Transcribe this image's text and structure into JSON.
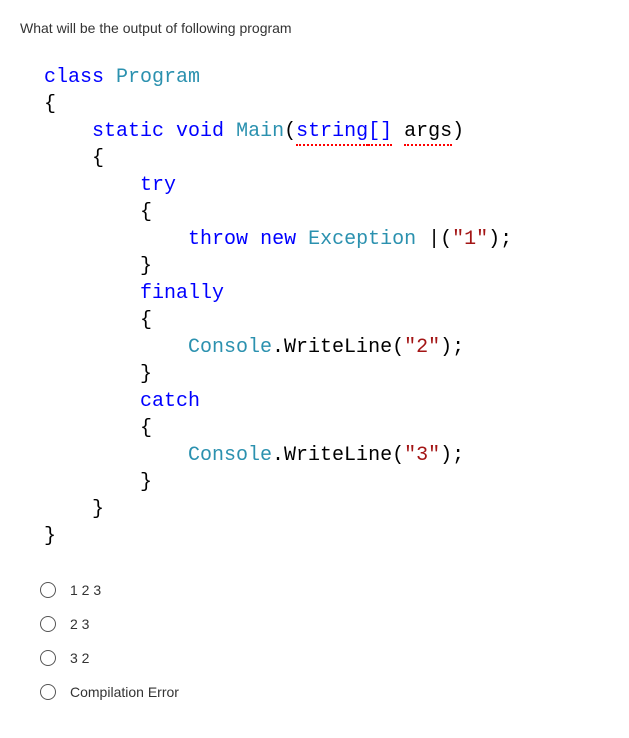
{
  "question": {
    "title": "What will be the output of following program"
  },
  "code": {
    "l1_kw1": "class",
    "l1_cls": "Program",
    "l2_brace": "{",
    "l3_kw1": "static",
    "l3_kw2": "void",
    "l3_main": "Main",
    "l3_paren_open": "(",
    "l3_str_type": "string",
    "l3_brackets": "[]",
    "l3_args": "args",
    "l3_paren_close": ")",
    "l4_brace": "{",
    "l5_try": "try",
    "l6_brace": "{",
    "l7_kw1": "throw",
    "l7_kw2": "new",
    "l7_exc": "Exception",
    "l7_sp": " |(",
    "l7_par_open": "(",
    "l7_str": "\"1\"",
    "l7_par_close": ");",
    "l8_brace": "}",
    "l9_finally": "finally",
    "l10_brace": "{",
    "l11_console": "Console",
    "l11_dot": ".WriteLine(",
    "l11_str": "\"2\"",
    "l11_close": ");",
    "l12_brace": "}",
    "l13_catch": "catch",
    "l14_brace": "{",
    "l15_console": "Console",
    "l15_dot": ".WriteLine(",
    "l15_str": "\"3\"",
    "l15_close": ");",
    "l16_brace": "}",
    "l17_brace": "}",
    "l18_brace": "}"
  },
  "options": {
    "items": [
      {
        "label": "1 2 3"
      },
      {
        "label": "2 3"
      },
      {
        "label": "3 2"
      },
      {
        "label": "Compilation Error"
      }
    ]
  }
}
